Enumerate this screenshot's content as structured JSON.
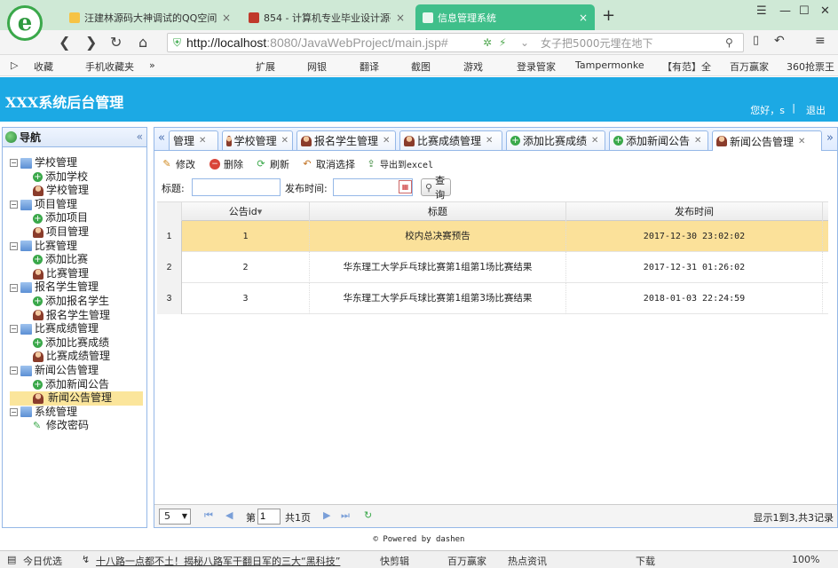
{
  "browser": {
    "tabs": [
      {
        "label": "汪建林源码大神调试的QQ空间",
        "active": false
      },
      {
        "label": "854 - 计算机专业毕业设计源码",
        "active": false
      },
      {
        "label": "信息管理系统",
        "active": true
      }
    ],
    "new_tab": "+",
    "url_host": "http://localhost",
    "url_rest": ":8080/JavaWebProject/main.jsp#",
    "search_hint": "女子把5000元埋在地下",
    "bookmarks": [
      "收藏",
      "手机收藏夹",
      "扩展",
      "网银",
      "翻译",
      "截图",
      "游戏",
      "登录管家",
      "Tampermonke",
      "【有范】全",
      "百万赢家",
      "360抢票王"
    ],
    "status": {
      "left": "今日优选",
      "news": "十八路一点都不土！揭秘八路军干翻日军的三大“黑科技”",
      "items": [
        "快剪辑",
        "百万赢家",
        "热点资讯",
        "下载",
        "100%"
      ]
    }
  },
  "app": {
    "title": "XXX系统后台管理",
    "greeting": "您好，s",
    "separator": "|",
    "logout": "退出",
    "footer": "© Powered by dashen"
  },
  "nav": {
    "title": "导航",
    "groups": [
      {
        "label": "学校管理",
        "children": [
          {
            "label": "添加学校",
            "icon": "add"
          },
          {
            "label": "学校管理",
            "icon": "user"
          }
        ]
      },
      {
        "label": "项目管理",
        "children": [
          {
            "label": "添加项目",
            "icon": "add"
          },
          {
            "label": "项目管理",
            "icon": "user"
          }
        ]
      },
      {
        "label": "比赛管理",
        "children": [
          {
            "label": "添加比赛",
            "icon": "add"
          },
          {
            "label": "比赛管理",
            "icon": "user"
          }
        ]
      },
      {
        "label": "报名学生管理",
        "children": [
          {
            "label": "添加报名学生",
            "icon": "add"
          },
          {
            "label": "报名学生管理",
            "icon": "user"
          }
        ]
      },
      {
        "label": "比赛成绩管理",
        "children": [
          {
            "label": "添加比赛成绩",
            "icon": "add"
          },
          {
            "label": "比赛成绩管理",
            "icon": "user"
          }
        ]
      },
      {
        "label": "新闻公告管理",
        "children": [
          {
            "label": "添加新闻公告",
            "icon": "add"
          },
          {
            "label": "新闻公告管理",
            "icon": "user",
            "selected": true
          }
        ]
      },
      {
        "label": "系统管理",
        "children": [
          {
            "label": "修改密码",
            "icon": "pen"
          }
        ]
      }
    ]
  },
  "tabs": [
    {
      "label": "管理",
      "icon": "none"
    },
    {
      "label": "学校管理",
      "icon": "user"
    },
    {
      "label": "报名学生管理",
      "icon": "user"
    },
    {
      "label": "比赛成绩管理",
      "icon": "user"
    },
    {
      "label": "添加比赛成绩",
      "icon": "add"
    },
    {
      "label": "添加新闻公告",
      "icon": "add"
    },
    {
      "label": "新闻公告管理",
      "icon": "user",
      "active": true
    }
  ],
  "toolbar": {
    "edit": "修改",
    "delete": "删除",
    "refresh": "刷新",
    "cancel_select": "取消选择",
    "export": "导出到excel"
  },
  "search": {
    "title_label": "标题:",
    "title_value": "",
    "time_label": "发布时间:",
    "time_value": "",
    "query": "查询"
  },
  "grid": {
    "columns": [
      "公告id",
      "标题",
      "发布时间"
    ],
    "sort_indicator": "▾",
    "rows": [
      {
        "rownum": "1",
        "id": "1",
        "title": "校内总决赛预告",
        "time": "2017-12-30 23:02:02",
        "selected": true
      },
      {
        "rownum": "2",
        "id": "2",
        "title": "华东理工大学乒乓球比赛第1组第1场比赛结果",
        "time": "2017-12-31 01:26:02",
        "selected": false
      },
      {
        "rownum": "3",
        "id": "3",
        "title": "华东理工大学乒乓球比赛第1组第3场比赛结果",
        "time": "2018-01-03 22:24:59",
        "selected": false
      }
    ]
  },
  "pager": {
    "page_size": "5",
    "page_prefix": "第",
    "page_value": "1",
    "page_suffix": "共1页",
    "info": "显示1到3,共3记录"
  }
}
